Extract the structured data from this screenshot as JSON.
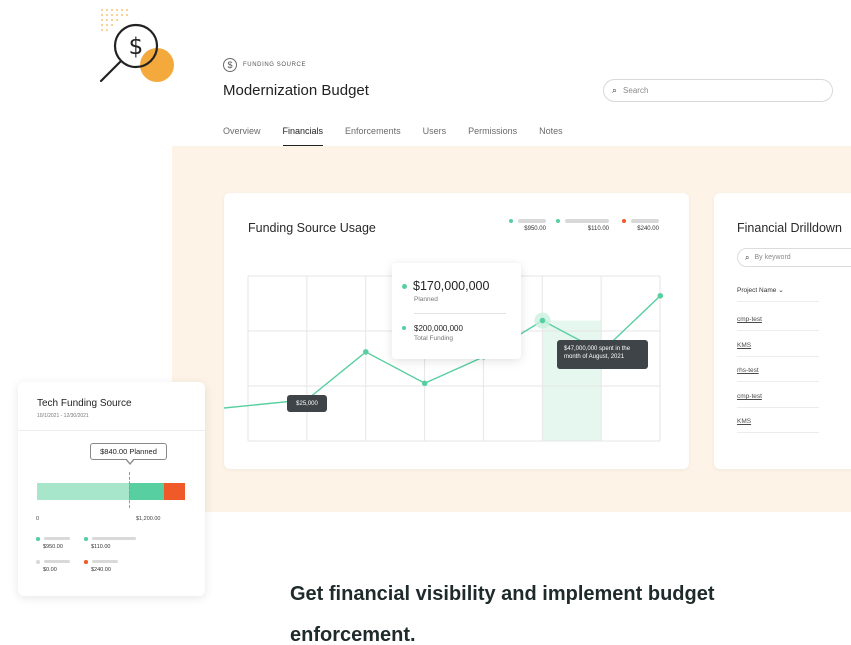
{
  "header": {
    "badge_icon": "dollar-coin-icon",
    "badge_label": "FUNDING SOURCE",
    "title": "Modernization Budget",
    "search_placeholder": "Search"
  },
  "tabs": [
    {
      "label": "Overview",
      "active": false
    },
    {
      "label": "Financials",
      "active": true
    },
    {
      "label": "Enforcements",
      "active": false
    },
    {
      "label": "Users",
      "active": false
    },
    {
      "label": "Permissions",
      "active": false
    },
    {
      "label": "Notes",
      "active": false
    }
  ],
  "colors": {
    "accent_green": "#58cfa0",
    "light_green": "#a8e6cc",
    "over_red": "#f05a28",
    "peach_bg": "#fdf3e7",
    "hero_orange": "#f4a93c"
  },
  "usage": {
    "title": "Funding Source Usage",
    "legend": [
      {
        "value": "$950.00",
        "color": "#58cfa0"
      },
      {
        "value": "$110.00",
        "color": "#58cfa0"
      },
      {
        "value": "$240.00",
        "color": "#f05a28"
      }
    ],
    "tooltip": {
      "amount": "$170,000,000",
      "amount_label": "Planned",
      "total": "$200,000,000",
      "total_label": "Total Funding"
    },
    "point_label": "$25,000",
    "spent_note": "$47,000,000 spent in the month of August, 2021"
  },
  "chart_data": {
    "type": "line",
    "title": "Funding Source Usage",
    "x": [
      0,
      1,
      2,
      3,
      4,
      5,
      6,
      7
    ],
    "y": [
      2.0,
      2.5,
      5.4,
      3.5,
      5.1,
      7.3,
      5.4,
      8.8
    ],
    "grid": true,
    "highlighted_index": 5
  },
  "drilldown": {
    "title": "Financial Drilldown",
    "search_placeholder": "By keyword",
    "column_header": "Project Name",
    "rows": [
      "cmp-test",
      "KMS",
      "rhs-test",
      "cmp-test",
      "KMS"
    ]
  },
  "tech": {
    "title": "Tech Funding Source",
    "date_range": "10/1/2021 - 12/30/2021",
    "planned_label": "$840.00 Planned",
    "axis_min": "0",
    "axis_max": "$1,200.00",
    "legend": [
      {
        "value": "$950.00",
        "color": "#58cfa0"
      },
      {
        "value": "$110.00",
        "color": "#58cfa0"
      },
      {
        "value": "$0.00",
        "color": "#d9d9d9"
      },
      {
        "value": "$240.00",
        "color": "#f05a28"
      }
    ]
  },
  "headline": "Get financial visibility and implement budget enforcement."
}
